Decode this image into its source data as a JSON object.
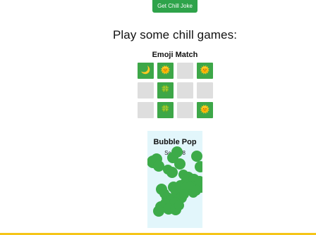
{
  "header": {
    "joke_button_label": "Get Chill Joke"
  },
  "main": {
    "heading": "Play some chill games:"
  },
  "emoji_match": {
    "title": "Emoji Match",
    "tiles": [
      {
        "state": "revealed",
        "icon": "moon-icon",
        "glyph": "🌙"
      },
      {
        "state": "revealed",
        "icon": "sun-icon",
        "glyph": "🌞"
      },
      {
        "state": "hidden",
        "icon": "",
        "glyph": ""
      },
      {
        "state": "revealed",
        "icon": "sun-icon",
        "glyph": "🌞"
      },
      {
        "state": "hidden",
        "icon": "",
        "glyph": ""
      },
      {
        "state": "revealed",
        "icon": "clover-icon",
        "glyph": "🍀"
      },
      {
        "state": "hidden",
        "icon": "",
        "glyph": ""
      },
      {
        "state": "hidden",
        "icon": "",
        "glyph": ""
      },
      {
        "state": "hidden",
        "icon": "",
        "glyph": ""
      },
      {
        "state": "revealed",
        "icon": "clover-icon",
        "glyph": "🍀"
      },
      {
        "state": "hidden",
        "icon": "",
        "glyph": ""
      },
      {
        "state": "revealed",
        "icon": "sun-icon",
        "glyph": "🌞"
      }
    ]
  },
  "bubble_pop": {
    "title": "Bubble Pop",
    "score_label": "Score",
    "score_value": "8",
    "bubble_count": 38
  },
  "colors": {
    "button": "#2ea34a",
    "tile_revealed": "#3da748",
    "tile_hidden": "#dedede",
    "bubble": "#3dab49",
    "bubble_panel": "#e2f6fb",
    "bottom_bar": "#f5c518"
  }
}
